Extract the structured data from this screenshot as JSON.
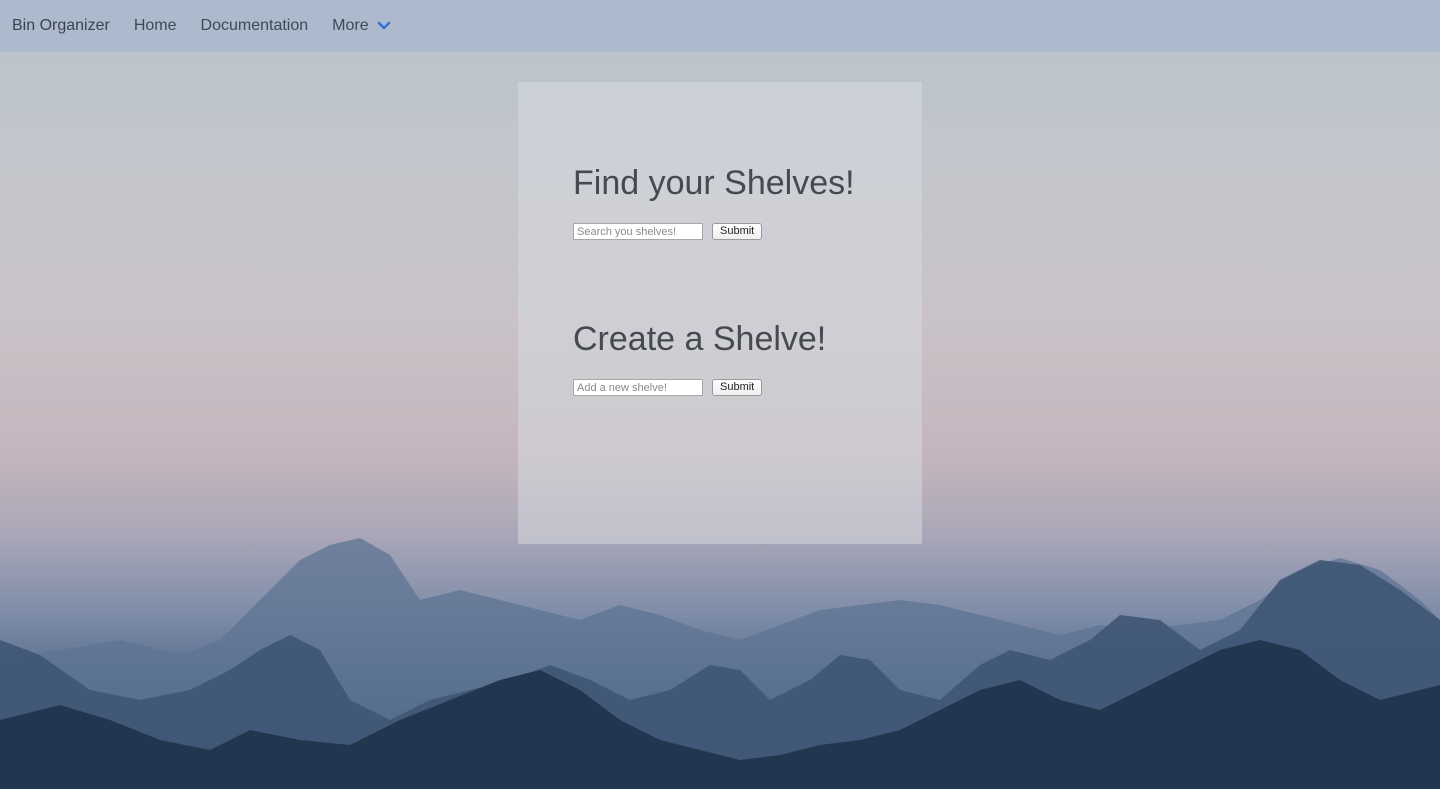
{
  "nav": {
    "brand": "Bin Organizer",
    "home": "Home",
    "documentation": "Documentation",
    "more": "More",
    "chevron_icon": "chevron-down-icon",
    "chevron_color": "#2f6fe0"
  },
  "search_section": {
    "heading": "Find your Shelves!",
    "input_placeholder": "Search you shelves!",
    "input_value": "",
    "submit_label": "Submit"
  },
  "create_section": {
    "heading": "Create a Shelve!",
    "input_placeholder": "Add a new shelve!",
    "input_value": "",
    "submit_label": "Submit"
  }
}
